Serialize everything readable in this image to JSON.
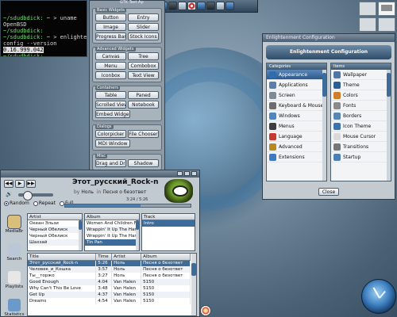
{
  "terminal": {
    "lines": [
      {
        "prompt": "~/sdudbdick:",
        "cmd": " ~ > uname"
      },
      {
        "prompt": "",
        "cmd": "OpenBSD"
      },
      {
        "prompt": "~/sdudbdick:",
        "cmd": ""
      },
      {
        "prompt": "~/sdudbdick:",
        "cmd": " ~ > enlighten"
      },
      {
        "prompt": "",
        "cmd": "config --version"
      },
      {
        "prompt": "",
        "cmd": "0.16.999.042",
        "highlight": true
      },
      {
        "prompt": "~/sdudbdick:",
        "cmd": ""
      },
      {
        "prompt": "~/sdudbdick:",
        "cmd": ""
      }
    ]
  },
  "shelf": {
    "title": "GTK Test Ap"
  },
  "gtk_window": {
    "groups": [
      {
        "title": "Basic Widgets",
        "buttons": [
          "Button",
          "Entry",
          "Image",
          "Slider",
          "Progress Bar",
          "Stock Icons"
        ]
      },
      {
        "title": "Advanced Widgets",
        "buttons": [
          "Canvas",
          "Tree",
          "Menu",
          "Combobox",
          "Iconbox",
          "Text View"
        ]
      },
      {
        "title": "Containers",
        "buttons": [
          "Table",
          "Paned",
          "Scrolled View",
          "Notebook",
          "Embed Widget"
        ]
      },
      {
        "title": "Dialogs",
        "buttons": [
          "Colorpicker",
          "File Chooser",
          "MDI Window"
        ]
      },
      {
        "title": "Misc",
        "buttons": [
          "Drag and Drop",
          "Shadow"
        ]
      }
    ]
  },
  "config_window": {
    "title": "Enlightenment Configuration",
    "banner": "Enlightenment Configuration",
    "left_head": "Categories",
    "right_head": "Items",
    "categories": [
      {
        "label": "Appearance",
        "icon": "appearance-icon",
        "color": "#2f6db0",
        "selected": true
      },
      {
        "label": "Applications",
        "icon": "applications-icon",
        "color": "#5a7fa8"
      },
      {
        "label": "Screen",
        "icon": "screen-icon",
        "color": "#7d8b96"
      },
      {
        "label": "Keyboard & Mouse",
        "icon": "keyboard-icon",
        "color": "#6d6d6d"
      },
      {
        "label": "Windows",
        "icon": "windows-icon",
        "color": "#4e86c0"
      },
      {
        "label": "Menus",
        "icon": "menus-icon",
        "color": "#3e3e3e"
      },
      {
        "label": "Language",
        "icon": "language-icon",
        "color": "#c63a2f"
      },
      {
        "label": "Advanced",
        "icon": "advanced-icon",
        "color": "#b58a1e"
      },
      {
        "label": "Extensions",
        "icon": "extensions-icon",
        "color": "#3f7ac0"
      }
    ],
    "items": [
      {
        "label": "Wallpaper",
        "icon": "wallpaper-icon",
        "color": "#5276a0"
      },
      {
        "label": "Theme",
        "icon": "theme-icon",
        "color": "#2d5d93"
      },
      {
        "label": "Colors",
        "icon": "colors-icon",
        "color": "#cf7f2b"
      },
      {
        "label": "Fonts",
        "icon": "fonts-icon",
        "color": "#8a8a8a"
      },
      {
        "label": "Borders",
        "icon": "borders-icon",
        "color": "#5a86b4"
      },
      {
        "label": "Icon Theme",
        "icon": "icon-theme-icon",
        "color": "#3b73ad"
      },
      {
        "label": "Mouse Cursor",
        "icon": "mouse-cursor-icon",
        "color": "#d9d9d9"
      },
      {
        "label": "Transitions",
        "icon": "transitions-icon",
        "color": "#777777"
      },
      {
        "label": "Startup",
        "icon": "startup-icon",
        "color": "#4d7fb5"
      }
    ],
    "close_label": "Close"
  },
  "player": {
    "song_title": "Этот_русский_Rock-n",
    "by_label": "by",
    "artist": "Ноль",
    "in_label": "in",
    "album": "Песня о безответ",
    "time": "3:24 / 5:26",
    "progress": 0.6,
    "toggles": [
      {
        "label": "Random",
        "on": true
      },
      {
        "label": "Repeat",
        "on": false
      },
      {
        "label": "Full",
        "on": false
      }
    ],
    "sidebar": [
      {
        "label": "MediaBr",
        "icon": "media-browser-icon",
        "color": "#d8c07a"
      },
      {
        "label": "Search",
        "icon": "search-icon",
        "color": "#b9c7d6"
      },
      {
        "label": "Playlists",
        "icon": "playlists-icon",
        "color": "#e7e7e7"
      },
      {
        "label": "Statistics",
        "icon": "statistics-icon",
        "color": "#6b99c9"
      }
    ],
    "browser": {
      "artist_header": "Artist",
      "artists": [
        "Океан Эльзи",
        "Черный Обелиск",
        "Черный Обелиск",
        "Шахзай"
      ],
      "album_header": "Album",
      "albums": [
        "Women And Children Fir",
        "Wrappin' It Up The Harri",
        "Wrappin' It Up The Har",
        "Tin Pan"
      ],
      "track_header": "Track",
      "tracks_col": [
        "Intro"
      ]
    },
    "tracks": {
      "headers": [
        "Title",
        "Time",
        "Artist",
        "Album"
      ],
      "rows": [
        [
          "Этот_русский_Rock-n",
          "5:26",
          "Ноль",
          "Песня о безответ"
        ],
        [
          "Человек_и_Кошка",
          "3:57",
          "Ноль",
          "Песня о безответ"
        ],
        [
          "Ты__торжо",
          "3:27",
          "Ноль",
          "Песня о безответ"
        ],
        [
          "Good Enough",
          "4:04",
          "Van Halen",
          "5150"
        ],
        [
          "Why Can't This Be Love",
          "3:48",
          "Van Halen",
          "5150"
        ],
        [
          "Get Up",
          "4:37",
          "Van Halen",
          "5150"
        ],
        [
          "Dreams",
          "4:54",
          "Van Halen",
          "5150"
        ]
      ]
    }
  }
}
